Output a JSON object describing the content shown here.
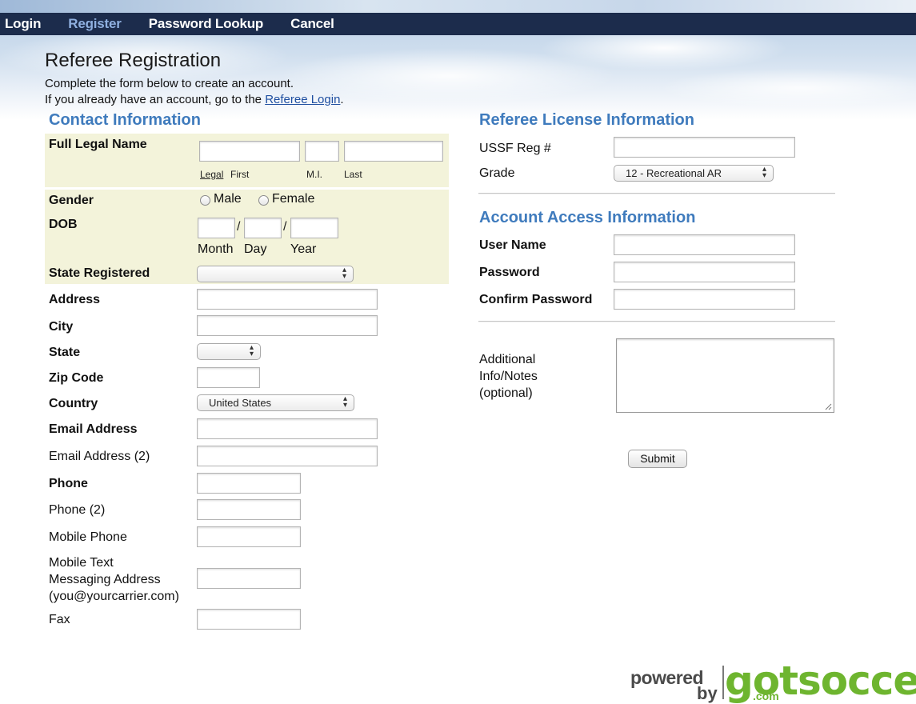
{
  "nav": {
    "login": "Login",
    "register": "Register",
    "password_lookup": "Password Lookup",
    "cancel": "Cancel"
  },
  "page": {
    "title": "Referee Registration",
    "intro_line1": "Complete the form below to create an account.",
    "intro_line2_prefix": "If you already have an account, go to the ",
    "intro_link": "Referee Login",
    "intro_line2_suffix": "."
  },
  "contact": {
    "heading": "Contact Information",
    "full_legal_name": "Full Legal Name",
    "name_sub_legal": "Legal",
    "name_sub_first": "First",
    "name_sub_mi": "M.I.",
    "name_sub_last": "Last",
    "gender": "Gender",
    "gender_male": "Male",
    "gender_female": "Female",
    "dob": "DOB",
    "dob_month": "Month",
    "dob_day": "Day",
    "dob_year": "Year",
    "dob_sep": "/",
    "state_registered": "State Registered",
    "state_registered_value": "",
    "address": "Address",
    "city": "City",
    "state": "State",
    "state_value": "",
    "zip": "Zip Code",
    "country": "Country",
    "country_value": "United States",
    "email": "Email Address",
    "email2": "Email Address (2)",
    "phone": "Phone",
    "phone2": "Phone (2)",
    "mobile": "Mobile Phone",
    "mobile_text_1": "Mobile Text",
    "mobile_text_2": "Messaging Address",
    "mobile_text_3": "(you@yourcarrier.com)",
    "fax": "Fax"
  },
  "license": {
    "heading": "Referee License Information",
    "ussf": "USSF Reg #",
    "grade": "Grade",
    "grade_value": "12 - Recreational AR"
  },
  "account": {
    "heading": "Account Access Information",
    "username": "User Name",
    "password": "Password",
    "confirm": "Confirm Password"
  },
  "notes": {
    "line1": "Additional",
    "line2": "Info/Notes",
    "line3": "(optional)"
  },
  "submit": "Submit",
  "logo": {
    "powered": "powered",
    "by": "by",
    "brand": "gotsoccer",
    "com": ".com"
  },
  "colors": {
    "nav_bg": "#1c2c4c",
    "nav_active": "#8fb0e0",
    "section_head": "#3f7bbd",
    "band": "#f3f3da",
    "brand_green": "#6eb52f"
  }
}
